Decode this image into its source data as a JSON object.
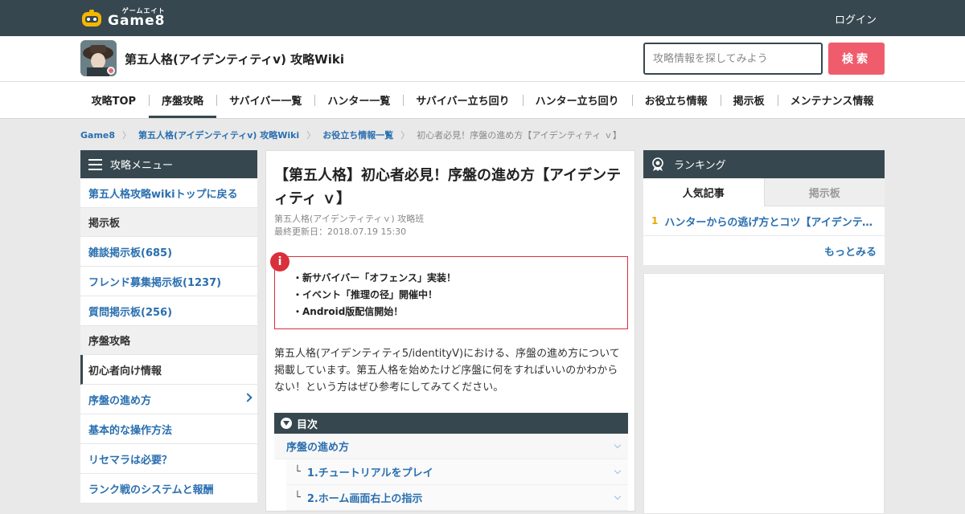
{
  "topbar": {
    "logo_small": "ゲームエイト",
    "logo_big": "Game8",
    "login_label": "ログイン"
  },
  "header": {
    "site_title": "第五人格(アイデンティティⅴ) 攻略Wiki",
    "search_placeholder": "攻略情報を探してみよう",
    "search_button": "検索"
  },
  "nav": {
    "items": [
      {
        "label": "攻略TOP"
      },
      {
        "label": "序盤攻略"
      },
      {
        "label": "サバイバー一覧"
      },
      {
        "label": "ハンター一覧"
      },
      {
        "label": "サバイバー立ち回り"
      },
      {
        "label": "ハンター立ち回り"
      },
      {
        "label": "お役立ち情報"
      },
      {
        "label": "掲示板"
      },
      {
        "label": "メンテナンス情報"
      }
    ],
    "active_index": 1
  },
  "breadcrumb": {
    "items": [
      "Game8",
      "第五人格(アイデンティティⅴ) 攻略Wiki",
      "お役立ち情報一覧"
    ],
    "current": "初心者必見！序盤の進め方【アイデンティティ ｖ】"
  },
  "sidebar": {
    "title": "攻略メニュー",
    "items": [
      {
        "label": "第五人格攻略wikiトップに戻る",
        "kind": "link"
      },
      {
        "label": "掲示板",
        "kind": "section"
      },
      {
        "label": "雑談掲示板(685)",
        "kind": "link"
      },
      {
        "label": "フレンド募集掲示板(1237)",
        "kind": "link"
      },
      {
        "label": "質問掲示板(256)",
        "kind": "link"
      },
      {
        "label": "序盤攻略",
        "kind": "section"
      },
      {
        "label": "初心者向け情報",
        "kind": "current"
      },
      {
        "label": "序盤の進め方",
        "kind": "link-expand"
      },
      {
        "label": "基本的な操作方法",
        "kind": "link"
      },
      {
        "label": "リセマラは必要？",
        "kind": "link"
      },
      {
        "label": "ランク戦のシステムと報酬",
        "kind": "link"
      }
    ]
  },
  "article": {
    "title": "【第五人格】初心者必見！序盤の進め方【アイデンティティ ｖ】",
    "author": "第五人格(アイデンティティｖ) 攻略班",
    "updated": "最終更新日：2018.07.19 15:30",
    "notice_icon": "i",
    "notice_lines": [
      "・新サバイバー「オフェンス」実装！",
      "・イベント「推理の径」開催中！",
      "・Android版配信開始！"
    ],
    "intro": "第五人格(アイデンティティ5/identityⅤ)における、序盤の進め方について掲載しています。第五人格を始めたけど序盤に何をすればいいのかわからない！という方はぜひ参考にしてみてください。",
    "toc": {
      "title": "目次",
      "items": [
        {
          "label": "序盤の進め方",
          "level": 1
        },
        {
          "label": "1.チュートリアルをプレイ",
          "level": 2
        },
        {
          "label": "2.ホーム画面右上の指示",
          "level": 2
        }
      ]
    }
  },
  "ranking": {
    "title": "ランキング",
    "tabs": [
      "人気記事",
      "掲示板"
    ],
    "items": [
      {
        "rank": "1",
        "label": "ハンターからの逃げ方とコツ【アイデンティティ ｖ】"
      }
    ],
    "more": "もっとみる"
  },
  "colors": {
    "header_dark": "#37474f",
    "link_blue": "#2a6fb0",
    "search_red": "#ef5d6d",
    "notice_red": "#d9303b",
    "rank_gold": "#e6a800"
  }
}
